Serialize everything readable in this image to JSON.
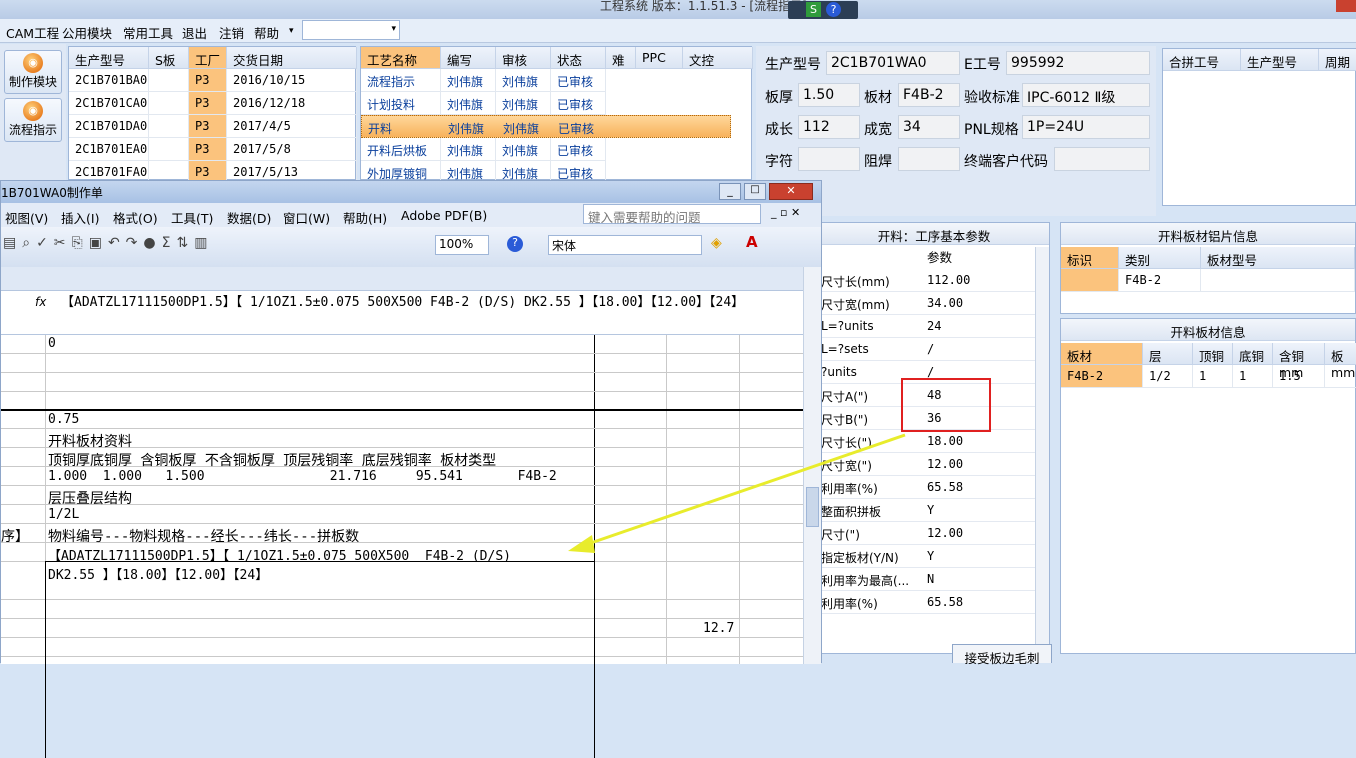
{
  "app": {
    "title": "工程系统  版本：1.1.51.3 - [流程指示]",
    "dropdown_value": ""
  },
  "menu": [
    "CAM工程",
    "公用模块",
    "常用工具",
    "退出",
    "注销",
    "帮助"
  ],
  "left_buttons": {
    "make": "制作模块",
    "flow": "流程指示"
  },
  "orders": {
    "headers": [
      "生产型号",
      "S板",
      "工厂",
      "交货日期"
    ],
    "rows": [
      [
        "2C1B701BA0",
        "",
        "P3",
        "2016/10/15"
      ],
      [
        "2C1B701CA0",
        "",
        "P3",
        "2016/12/18"
      ],
      [
        "2C1B701DA0",
        "",
        "P3",
        "2017/4/5"
      ],
      [
        "2C1B701EA0",
        "",
        "P3",
        "2017/5/8"
      ],
      [
        "2C1B701FA0",
        "",
        "P3",
        "2017/5/13"
      ]
    ]
  },
  "process": {
    "headers": [
      "工艺名称",
      "编写",
      "审核",
      "状态",
      "难",
      "PPC",
      "文控"
    ],
    "rows": [
      [
        "流程指示",
        "刘伟旗",
        "刘伟旗",
        "已审核"
      ],
      [
        "计划投料",
        "刘伟旗",
        "刘伟旗",
        "已审核"
      ],
      [
        "开料",
        "刘伟旗",
        "刘伟旗",
        "已审核"
      ],
      [
        "开料后烘板",
        "刘伟旗",
        "刘伟旗",
        "已审核"
      ],
      [
        "外加厚镀铜",
        "刘伟旗",
        "刘伟旗",
        "已审核"
      ]
    ]
  },
  "info": {
    "model_label": "生产型号",
    "model": "2C1B701WA0",
    "eno_label": "E工号",
    "eno": "995992",
    "thick_label": "板厚",
    "thick": "1.50",
    "mat_label": "板材",
    "mat": "F4B-2",
    "std_label": "验收标准",
    "std": "IPC-6012 Ⅱ级",
    "len_label": "成长",
    "len": "112",
    "wid_label": "成宽",
    "wid": "34",
    "pnl_label": "PNL规格",
    "pnl": "1P=24U",
    "char_label": "字符",
    "mask_label": "阻焊",
    "cust_label": "终端客户代码"
  },
  "merge": {
    "headers": [
      "合拼工号",
      "生产型号",
      "周期"
    ]
  },
  "params": {
    "title": "开料：工序基本参数",
    "col": "参数",
    "rows": [
      [
        "尺寸长(mm)",
        "112.00"
      ],
      [
        "尺寸宽(mm)",
        "34.00"
      ],
      [
        "L=?units",
        "24"
      ],
      [
        "L=?sets",
        "/"
      ],
      [
        "?units",
        "/"
      ],
      [
        "尺寸A(\")",
        "48"
      ],
      [
        "尺寸B(\")",
        "36"
      ],
      [
        "尺寸长(\")",
        "18.00"
      ],
      [
        "尺寸宽(\")",
        "12.00"
      ],
      [
        "利用率(%)",
        "65.58"
      ],
      [
        "整面积拼板",
        "Y"
      ],
      [
        "尺寸(\")",
        "12.00"
      ],
      [
        "指定板材(Y/N)",
        "Y"
      ],
      [
        "利用率为最高(...",
        "N"
      ],
      [
        "利用率(%)",
        "65.58"
      ]
    ],
    "bottom_button": "接受板边毛刺"
  },
  "sheetinfo": {
    "title": "开料板材铝片信息",
    "headers": [
      "标识",
      "类别",
      "板材型号"
    ],
    "row": [
      "",
      "F4B-2",
      ""
    ]
  },
  "matinfo": {
    "title": "开料板材信息",
    "headers": [
      "板材",
      "层",
      "顶铜",
      "底铜",
      "含铜mm",
      "板mm"
    ],
    "row": [
      "F4B-2",
      "1/2",
      "1",
      "1",
      "1.5",
      ""
    ]
  },
  "excel": {
    "title": "1B701WA0制作单",
    "menu": [
      "视图(V)",
      "插入(I)",
      "格式(O)",
      "工具(T)",
      "数据(D)",
      "窗口(W)",
      "帮助(H)",
      "Adobe PDF(B)"
    ],
    "help_placeholder": "键入需要帮助的问题",
    "zoom": "100%",
    "font": "宋体",
    "formula": "【ADATZL17111500DP1.5】【 1/1OZ1.5±0.075 500X500  F4B-2 (D/S) DK2.55 】【18.00】【12.00】【24】",
    "cells": {
      "r0": "0",
      "r1": "0.75",
      "r2": "开料板材资料",
      "r3": "顶铜厚底铜厚 含铜板厚 不含铜板厚 顶层残铜率 底层残铜率 板材类型",
      "r4": "1.000  1.000   1.500                21.716     95.541       F4B-2",
      "r5": "层压叠层结构",
      "r6": "1/2L",
      "r7a": "序】",
      "r7": "物料编号---物料规格---经长---纬长---拼板数",
      "r8": "【ADATZL17111500DP1.5】【 1/1OZ1.5±0.075 500X500  F4B-2 (D/S)",
      "r9": "DK2.55 】【18.00】【12.00】【24】",
      "r10": "12.7"
    }
  }
}
